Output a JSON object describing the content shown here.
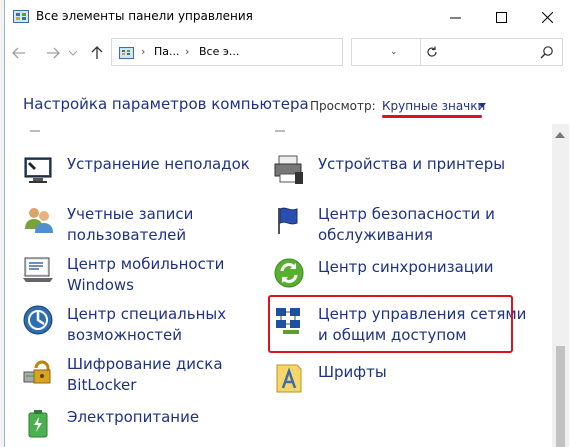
{
  "window": {
    "title": "Все элементы панели управления",
    "minimize_icon": "minimize-icon",
    "maximize_icon": "maximize-icon",
    "close_icon": "close-icon"
  },
  "address_bar": {
    "breadcrumbs": [
      "Па...",
      "Все э..."
    ],
    "refresh_icon": "refresh-icon"
  },
  "search": {
    "placeholder": "",
    "icon": "search-icon"
  },
  "header": {
    "title": "Настройка параметров компьютера",
    "view_label": "Просмотр:",
    "view_value": "Крупные значки"
  },
  "items": [
    {
      "label": "Устранение неполадок",
      "icon": "troubleshooting-icon"
    },
    {
      "label": "Устройства и принтеры",
      "icon": "devices-printers-icon"
    },
    {
      "label": "Учетные записи\nпользователей",
      "icon": "user-accounts-icon"
    },
    {
      "label": "Центр безопасности и\nобслуживания",
      "icon": "security-maintenance-icon"
    },
    {
      "label": "Центр мобильности\nWindows",
      "icon": "mobility-center-icon"
    },
    {
      "label": "Центр синхронизации",
      "icon": "sync-center-icon"
    },
    {
      "label": "Центр специальных\nвозможностей",
      "icon": "ease-of-access-icon"
    },
    {
      "label": "Центр управления сетями\nи общим доступом",
      "icon": "network-sharing-icon"
    },
    {
      "label": "Шифрование диска\nBitLocker",
      "icon": "bitlocker-icon"
    },
    {
      "label": "Шрифты",
      "icon": "fonts-icon"
    },
    {
      "label": "Электропитание",
      "icon": "power-options-icon"
    }
  ],
  "colors": {
    "link": "#1e3287",
    "highlight": "#d7141f"
  }
}
